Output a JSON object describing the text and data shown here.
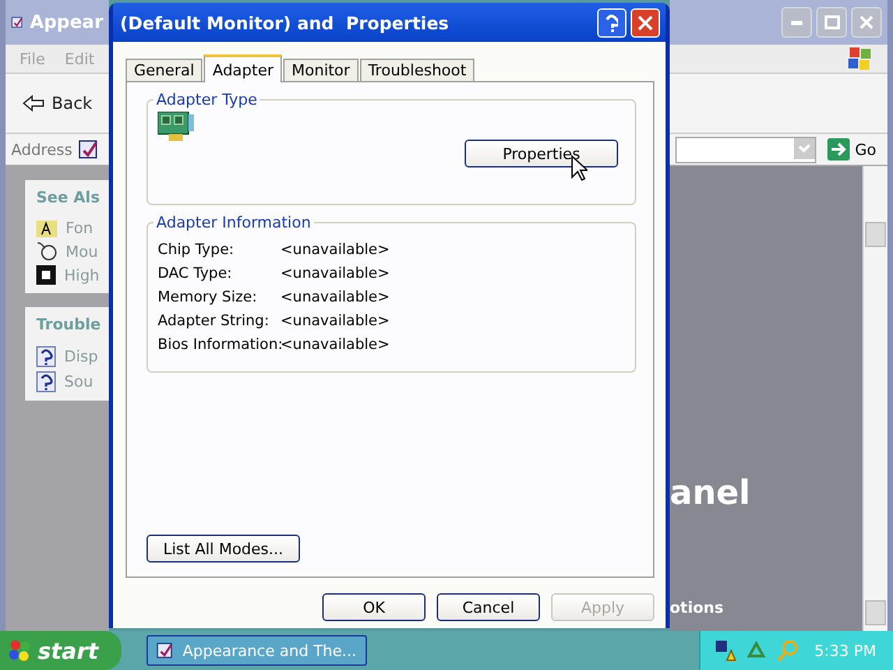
{
  "background_window": {
    "title": "Appear",
    "menu": [
      {
        "label": "File"
      },
      {
        "label": "Edit"
      }
    ],
    "back_button": "Back",
    "address_label": "Address",
    "go_button": "Go",
    "see_also": {
      "title": "See Als",
      "items": [
        {
          "label": "Fon"
        },
        {
          "label": "Mou"
        },
        {
          "label": "High"
        }
      ]
    },
    "troubleshooters": {
      "title": "Trouble",
      "items": [
        {
          "label": "Disp"
        },
        {
          "label": "Sou"
        }
      ]
    },
    "heading": "anel",
    "link": "otions"
  },
  "dialog": {
    "title": "(Default Monitor) and  Properties",
    "tabs": [
      {
        "label": "General",
        "selected": false
      },
      {
        "label": "Adapter",
        "selected": true
      },
      {
        "label": "Monitor",
        "selected": false
      },
      {
        "label": "Troubleshoot",
        "selected": false
      }
    ],
    "adapter_type": {
      "title": "Adapter Type",
      "properties_button": "Properties"
    },
    "adapter_information": {
      "title": "Adapter Information",
      "rows": [
        {
          "label": "Chip Type:",
          "value": "<unavailable>"
        },
        {
          "label": "DAC Type:",
          "value": "<unavailable>"
        },
        {
          "label": "Memory Size:",
          "value": "<unavailable>"
        },
        {
          "label": "Adapter String:",
          "value": "<unavailable>"
        },
        {
          "label": "Bios Information:",
          "value": "<unavailable>"
        }
      ]
    },
    "list_modes_button": "List All Modes...",
    "buttons": [
      {
        "label": "OK",
        "disabled": false
      },
      {
        "label": "Cancel",
        "disabled": false
      },
      {
        "label": "Apply",
        "disabled": true
      }
    ]
  },
  "taskbar": {
    "start": "start",
    "tasks": [
      {
        "label": "Appearance and The...",
        "selected": false
      }
    ],
    "clock": "5:33 PM"
  }
}
